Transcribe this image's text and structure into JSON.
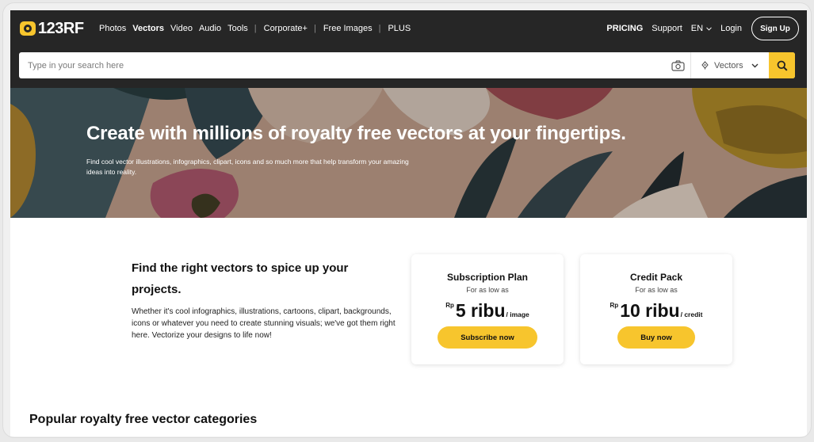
{
  "logo": {
    "text": "123RF"
  },
  "nav": {
    "items": [
      "Photos",
      "Vectors",
      "Video",
      "Audio",
      "Tools"
    ],
    "secondary": [
      "Corporate+",
      "Free Images",
      "PLUS"
    ]
  },
  "right_nav": {
    "pricing": "PRICING",
    "support": "Support",
    "language": "EN",
    "login": "Login",
    "signup": "Sign Up"
  },
  "search": {
    "placeholder": "Type in your search here",
    "type_selected": "Vectors"
  },
  "hero": {
    "title": "Create with millions of royalty free vectors at your fingertips.",
    "subtitle": "Find cool vector illustrations, infographics, clipart, icons and so much more that help transform your amazing ideas into reality."
  },
  "intro": {
    "title": "Find the right vectors to spice up your projects.",
    "text": "Whether it's cool infographics, illustrations, cartoons, clipart, backgrounds, icons or whatever you need to create stunning visuals; we've got them right here. Vectorize your designs to life now!"
  },
  "plans": [
    {
      "title": "Subscription Plan",
      "sub": "For as low as",
      "currency": "Rp",
      "amount": "5 ribu",
      "unit": "/ image",
      "button": "Subscribe now"
    },
    {
      "title": "Credit Pack",
      "sub": "For as low as",
      "currency": "Rp",
      "amount": "10 ribu",
      "unit": "/ credit",
      "button": "Buy now"
    }
  ],
  "popular": {
    "title": "Popular royalty free vector categories"
  },
  "colors": {
    "accent": "#f7c52d",
    "header_bg": "#262626"
  }
}
